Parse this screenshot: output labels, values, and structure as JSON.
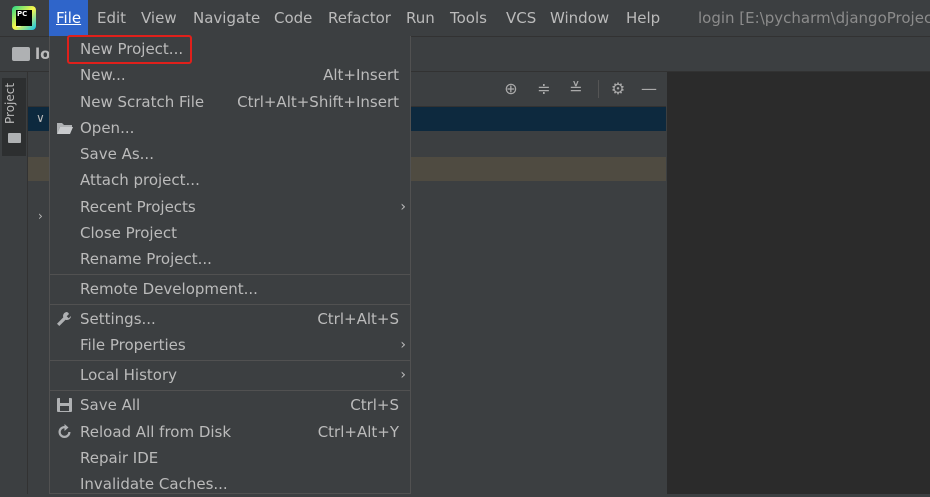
{
  "menubar": {
    "items": [
      "File",
      "Edit",
      "View",
      "Navigate",
      "Code",
      "Refactor",
      "Run",
      "Tools",
      "VCS",
      "Window",
      "Help"
    ],
    "active": "File",
    "window_title": "login [E:\\pycharm\\djangoProject"
  },
  "navbar": {
    "project_label": "lo"
  },
  "tool_window": {
    "label": "Project"
  },
  "file_menu": {
    "items": [
      {
        "label": "New Project...",
        "shortcut": ""
      },
      {
        "label": "New...",
        "shortcut": "Alt+Insert"
      },
      {
        "label": "New Scratch File",
        "shortcut": "Ctrl+Alt+Shift+Insert"
      },
      {
        "label": "Open...",
        "shortcut": "",
        "icon": "folder-open-icon"
      },
      {
        "label": "Save As...",
        "shortcut": ""
      },
      {
        "label": "Attach project...",
        "shortcut": ""
      },
      {
        "label": "Recent Projects",
        "shortcut": "",
        "submenu": true
      },
      {
        "label": "Close Project",
        "shortcut": ""
      },
      {
        "label": "Rename Project...",
        "shortcut": ""
      },
      {
        "label": "Remote Development...",
        "shortcut": ""
      },
      {
        "label": "Settings...",
        "shortcut": "Ctrl+Alt+S",
        "icon": "wrench-icon"
      },
      {
        "label": "File Properties",
        "shortcut": "",
        "submenu": true
      },
      {
        "label": "Local History",
        "shortcut": "",
        "submenu": true
      },
      {
        "label": "Save All",
        "shortcut": "Ctrl+S",
        "icon": "save-icon"
      },
      {
        "label": "Reload All from Disk",
        "shortcut": "Ctrl+Alt+Y",
        "icon": "reload-icon"
      },
      {
        "label": "Repair IDE",
        "shortcut": ""
      },
      {
        "label": "Invalidate Caches...",
        "shortcut": ""
      }
    ]
  },
  "colors": {
    "accent": "#2f65ca",
    "highlight_box": "#e0201b",
    "background": "#3c3f41",
    "editor": "#2b2b2b"
  }
}
